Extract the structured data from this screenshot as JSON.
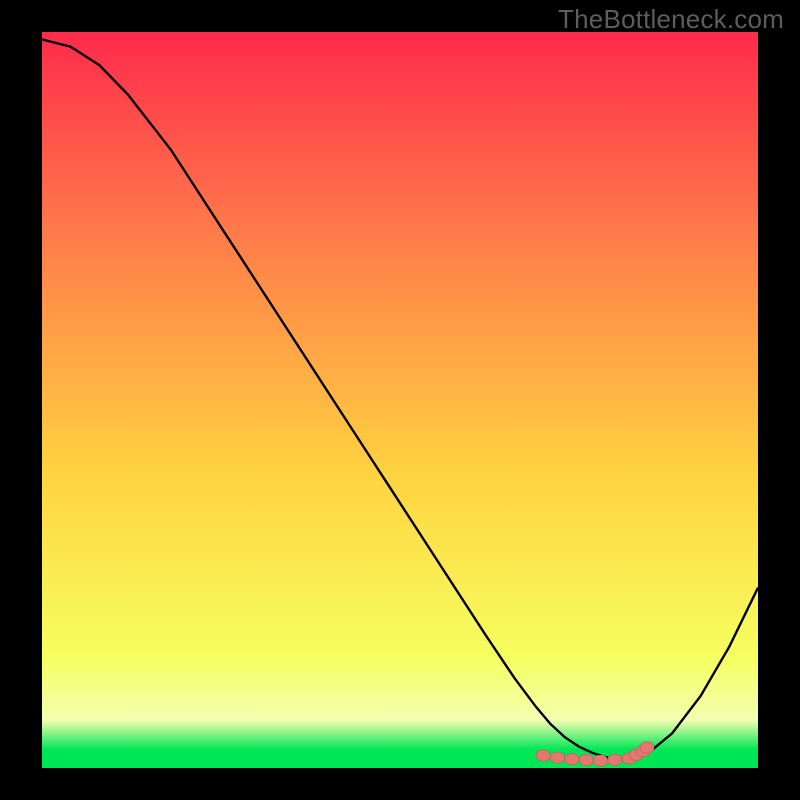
{
  "watermark": "TheBottleneck.com",
  "colors": {
    "bg": "#000000",
    "curve": "#000000",
    "marker_fill": "#e2786f",
    "marker_stroke": "#c65d55",
    "grad_top": "#ff2a4b",
    "grad_upper": "#ff7a4a",
    "grad_mid": "#ffd340",
    "grad_lower": "#f6ff60",
    "grad_band": "#f3ffb0",
    "grad_bottom": "#00e756"
  },
  "chart_data": {
    "type": "line",
    "title": "",
    "xlabel": "",
    "ylabel": "",
    "xlim": [
      0,
      100
    ],
    "ylim": [
      0,
      100
    ],
    "curve": {
      "x": [
        0,
        4,
        8,
        12,
        18,
        25,
        33,
        42,
        52,
        62,
        66,
        69,
        71,
        73,
        75,
        77,
        79,
        81,
        83,
        85,
        88,
        92,
        96,
        100
      ],
      "y": [
        99,
        98,
        95.5,
        91.5,
        84,
        73.5,
        61.5,
        48,
        33,
        18,
        12.2,
        8.3,
        6.0,
        4.2,
        2.9,
        2.0,
        1.4,
        1.2,
        1.5,
        2.3,
        4.7,
        9.8,
        16.5,
        24.5
      ]
    },
    "series": [
      {
        "name": "markers",
        "x": [
          70,
          72,
          74,
          76,
          78,
          80,
          82,
          83,
          84,
          84.5
        ],
        "y": [
          1.7,
          1.4,
          1.2,
          1.1,
          1.0,
          1.1,
          1.3,
          1.8,
          2.3,
          2.8
        ]
      }
    ],
    "gradient_stops": [
      {
        "offset": 0.0,
        "key": "grad_top"
      },
      {
        "offset": 0.27,
        "key": "grad_upper"
      },
      {
        "offset": 0.6,
        "key": "grad_mid"
      },
      {
        "offset": 0.85,
        "key": "grad_lower"
      },
      {
        "offset": 0.935,
        "key": "grad_band"
      },
      {
        "offset": 0.975,
        "key": "grad_bottom"
      },
      {
        "offset": 1.0,
        "key": "grad_bottom"
      }
    ]
  }
}
